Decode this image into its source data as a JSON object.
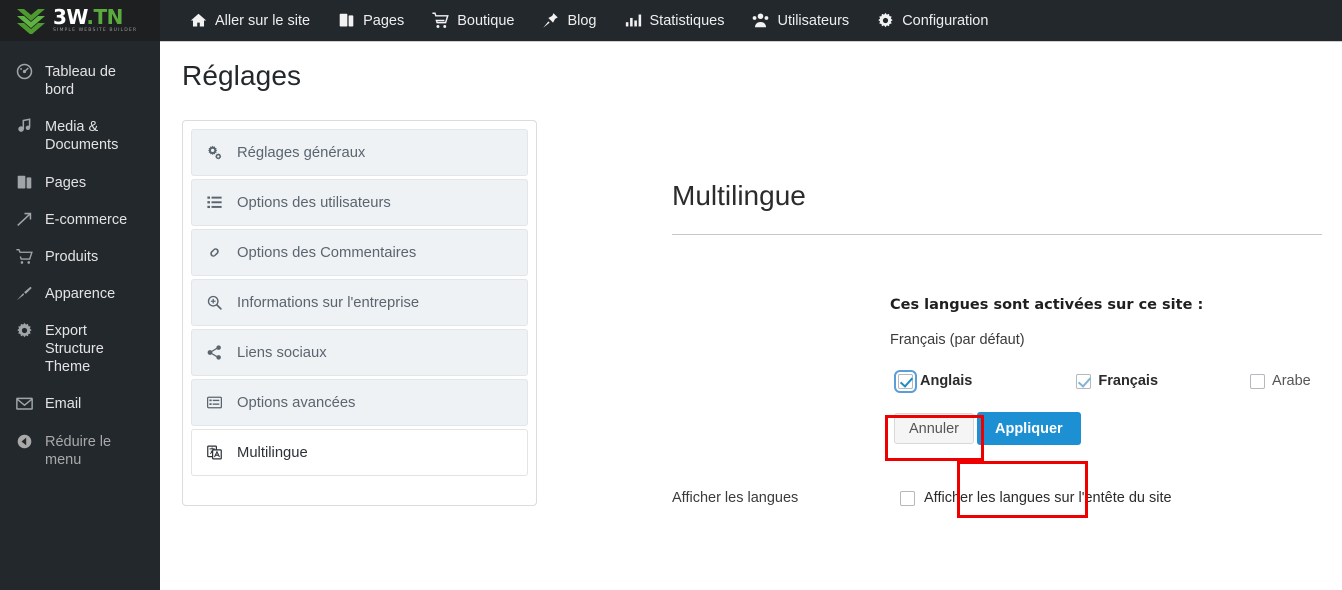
{
  "brand": {
    "title_main": "3W",
    "title_tld": ".TN",
    "subtitle": "SIMPLE WEBSITE BUILDER",
    "icon": "chevron-stack-logo",
    "accent_green": "#5aab3d"
  },
  "topnav": {
    "items": [
      {
        "label": "Aller sur le site",
        "icon": "home-icon"
      },
      {
        "label": "Pages",
        "icon": "pages-icon"
      },
      {
        "label": "Boutique",
        "icon": "cart-icon"
      },
      {
        "label": "Blog",
        "icon": "pin-icon"
      },
      {
        "label": "Statistiques",
        "icon": "chart-icon"
      },
      {
        "label": "Utilisateurs",
        "icon": "users-icon"
      },
      {
        "label": "Configuration",
        "icon": "gear-icon"
      }
    ]
  },
  "sidebar": {
    "items": [
      {
        "label": "Tableau de bord",
        "icon": "dashboard-icon",
        "muted": false
      },
      {
        "label": "Media & Documents",
        "icon": "media-icon",
        "muted": false
      },
      {
        "label": "Pages",
        "icon": "pages-icon",
        "muted": false
      },
      {
        "label": "E-commerce",
        "icon": "ecommerce-icon",
        "muted": false
      },
      {
        "label": "Produits",
        "icon": "cart-icon",
        "muted": false
      },
      {
        "label": "Apparence",
        "icon": "brush-icon",
        "muted": false
      },
      {
        "label": "Export Structure Theme",
        "icon": "gear-icon",
        "muted": false
      },
      {
        "label": "Email",
        "icon": "envelope-icon",
        "muted": false
      },
      {
        "label": "Réduire le menu",
        "icon": "collapse-arrow-icon",
        "muted": true
      }
    ]
  },
  "page": {
    "title": "Réglages"
  },
  "settings_tabs": {
    "items": [
      {
        "label": "Réglages généraux",
        "icon": "cogs-icon",
        "active": false
      },
      {
        "label": "Options des utilisateurs",
        "icon": "list-ul-icon",
        "active": false
      },
      {
        "label": "Options des Commentaires",
        "icon": "link-chain-icon",
        "active": false
      },
      {
        "label": "Informations sur l'entreprise",
        "icon": "search-plus-icon",
        "active": false
      },
      {
        "label": "Liens sociaux",
        "icon": "share-alt-icon",
        "active": false
      },
      {
        "label": "Options avancées",
        "icon": "list-alt-icon",
        "active": false
      },
      {
        "label": "Multilingue",
        "icon": "language-icon",
        "active": true
      }
    ]
  },
  "panel": {
    "title": "Multilingue",
    "languages_heading": "Ces langues sont activées sur ce site :",
    "default_language": "Français (par défaut)",
    "options": [
      {
        "label": "Anglais",
        "checked": true,
        "disabled": false,
        "bold": true,
        "focused": true
      },
      {
        "label": "Français",
        "checked": true,
        "disabled": true,
        "bold": true,
        "focused": false
      },
      {
        "label": "Arabe",
        "checked": false,
        "disabled": false,
        "bold": false,
        "focused": false
      }
    ],
    "cancel_label": "Annuler",
    "apply_label": "Appliquer",
    "display_languages_label": "Afficher les langues",
    "display_languages_checkbox_label": "Afficher les langues sur l'entête du site",
    "display_languages_checked": false,
    "apply_color": "#1d8fd3"
  },
  "highlights": {
    "anglais_box_color": "#ef0000",
    "apply_box_color": "#ef0000"
  }
}
